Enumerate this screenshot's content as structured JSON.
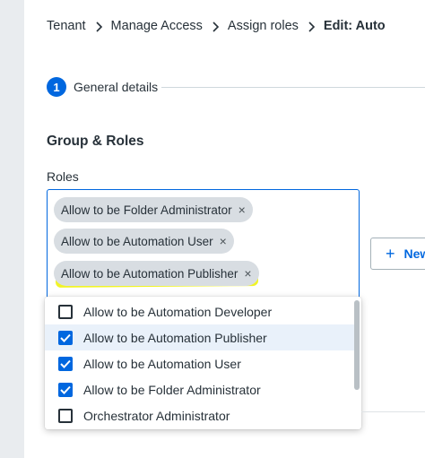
{
  "breadcrumb": [
    {
      "label": "Tenant"
    },
    {
      "label": "Manage Access"
    },
    {
      "label": "Assign roles"
    },
    {
      "label": "Edit: Auto"
    }
  ],
  "step": {
    "number": "1",
    "label": "General details"
  },
  "section_title": "Group & Roles",
  "roles": {
    "label": "Roles",
    "chips": [
      {
        "label": "Allow to be Folder Administrator",
        "remove": "×"
      },
      {
        "label": "Allow to be Automation User",
        "remove": "×"
      },
      {
        "label": "Allow to be Automation Publisher",
        "remove": "×"
      }
    ]
  },
  "new_button": {
    "plus": "+",
    "label": "New"
  },
  "dropdown": {
    "options": [
      {
        "label": "Allow to be Automation Developer",
        "checked": false
      },
      {
        "label": "Allow to be Automation Publisher",
        "checked": true
      },
      {
        "label": "Allow to be Automation User",
        "checked": true
      },
      {
        "label": "Allow to be Folder Administrator",
        "checked": true
      },
      {
        "label": "Orchestrator Administrator",
        "checked": false
      }
    ]
  },
  "colors": {
    "accent": "#0067df",
    "highlight": "#eef200",
    "chip": "#d8dde2"
  }
}
